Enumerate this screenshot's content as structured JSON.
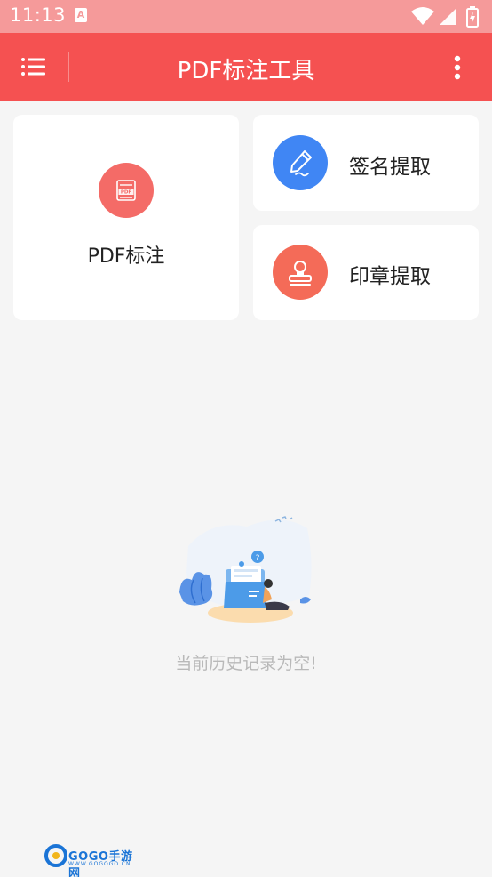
{
  "status_bar": {
    "time": "11:13",
    "notification_letter": "A",
    "icons": [
      "wifi-icon",
      "cell-signal-icon",
      "battery-icon"
    ]
  },
  "app_bar": {
    "title": "PDF标注工具",
    "menu_icon": "menu-icon",
    "more_icon": "more-vert-icon"
  },
  "tools": {
    "pdf_annotate": {
      "label": "PDF标注",
      "icon": "pdf-file-icon",
      "color": "#f46b67"
    },
    "signature_extract": {
      "label": "签名提取",
      "icon": "pen-icon",
      "color": "#4086f4"
    },
    "stamp_extract": {
      "label": "印章提取",
      "icon": "stamp-icon",
      "color": "#f46b58"
    }
  },
  "history": {
    "empty_text": "当前历史记录为空!",
    "illustration": "empty-folder-illustration"
  },
  "watermark": {
    "brand": "GOGO手游网",
    "url": "WWW.GOGOGO.CN"
  },
  "colors": {
    "status_bar": "#f59a9a",
    "app_bar": "#f55151",
    "background": "#f5f5f5"
  }
}
